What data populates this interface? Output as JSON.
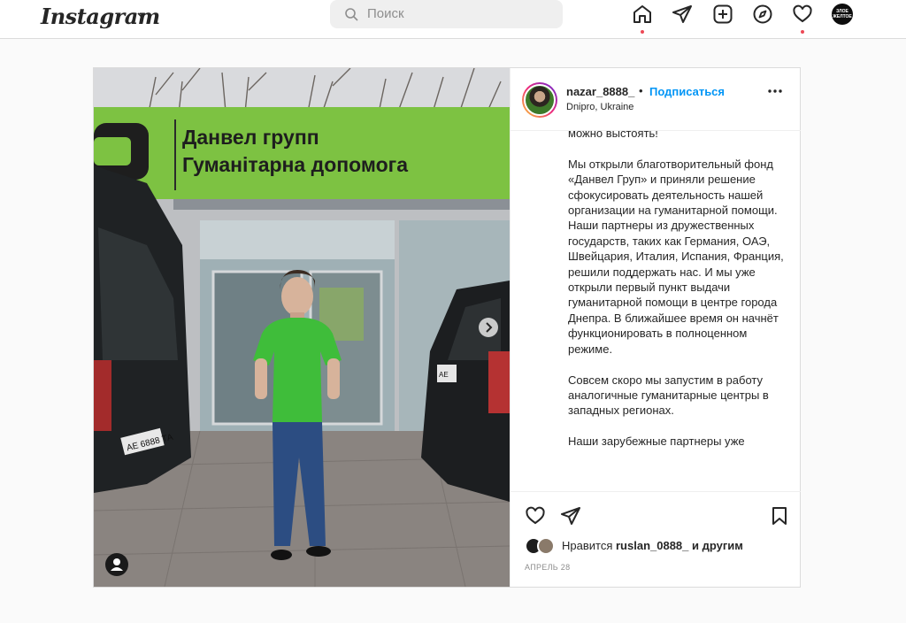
{
  "nav": {
    "logo": "Instagram",
    "search_placeholder": "Поиск",
    "profile_badge": "ЗЛОЕ ЖЕЛТОЕ",
    "icons": [
      "home-icon",
      "direct-icon",
      "new-post-icon",
      "explore-icon",
      "activity-icon",
      "profile-avatar"
    ]
  },
  "post": {
    "photo": {
      "sign_line1": "Данвел групп",
      "sign_line2": "Гуманітарна допомога",
      "plate_left": "АЕ 6888 ТА",
      "plate_right": "АЕ"
    },
    "header": {
      "username": "nazar_8888_",
      "bullet": "•",
      "follow_label": "Подписаться",
      "location": "Dnipro, Ukraine"
    },
    "caption": "можно выстоять!\n\nМы открыли благотворительный фонд «Данвел Груп» и приняли решение сфокусировать деятельность нашей организации на гуманитарной помощи. Наши партнеры из дружественных государств, таких как Германия, ОАЭ, Швейцария, Италия, Испания, Франция, решили поддержать нас. И мы уже открыли первый пункт выдачи гуманитарной помощи в центре города Днепра. В ближайшее время он начнёт функционировать в полноценном режиме.\n\nСовсем скоро мы запустим в работу аналогичные гуманитарные центры в западных регионах.\n\nНаши зарубежные партнеры уже",
    "likes": {
      "prefix": "Нравится",
      "user": "ruslan_0888_",
      "suffix": "и другим"
    },
    "date": "апрель 28"
  },
  "colors": {
    "accent_blue": "#0095f6",
    "notification_red": "#ed4956",
    "sign_green": "#7dc242"
  }
}
